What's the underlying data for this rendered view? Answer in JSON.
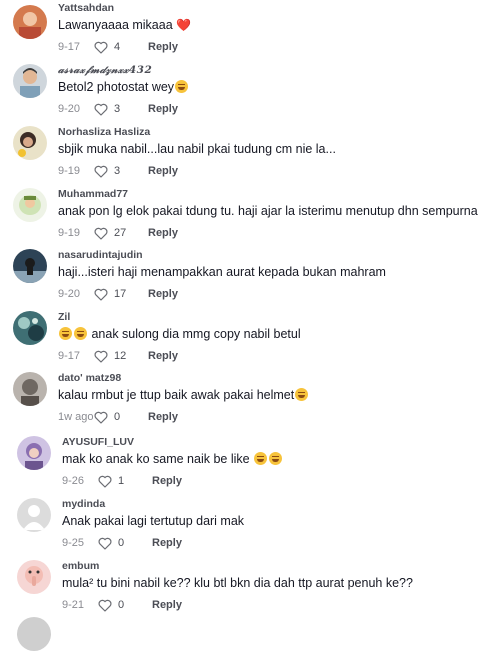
{
  "comments": [
    {
      "user": "Yattsahdan",
      "text": "Lawanyaaaa mikaaa",
      "suffix": "❤️",
      "date": "9-17",
      "likes": "4",
      "reply": "Reply"
    },
    {
      "user": "𝒶𝓈𝓇𝒶𝓍𝒻𝓂𝒹𝓏𝓃𝓍𝓍432",
      "text": "Betol2 photostat wey",
      "suffix": "😂",
      "date": "9-20",
      "likes": "3",
      "reply": "Reply"
    },
    {
      "user": "Norhasliza Hasliza",
      "text": "sbjik muka nabil...lau nabil pkai tudung cm nie la...",
      "suffix": "",
      "date": "9-19",
      "likes": "3",
      "reply": "Reply"
    },
    {
      "user": "Muhammad77",
      "text": "anak pon lg elok pakai tdung tu. haji ajar la isterimu menutup dhn sempurna",
      "suffix": "",
      "date": "9-19",
      "likes": "27",
      "reply": "Reply"
    },
    {
      "user": "nasarudintajudin",
      "text": "haji...isteri haji menampakkan aurat kepada bukan mahram",
      "suffix": "",
      "date": "9-20",
      "likes": "17",
      "reply": "Reply"
    },
    {
      "user": "Zil",
      "prefix": "🤣🤣",
      "text": " anak sulong dia mmg copy nabil betul",
      "suffix": "",
      "date": "9-17",
      "likes": "12",
      "reply": "Reply"
    },
    {
      "user": "dato' matz98",
      "text": "kalau rmbut je ttup baik awak pakai helmet",
      "suffix": "😂",
      "date": "1w ago",
      "likes": "0",
      "reply": "Reply"
    },
    {
      "user": "AYUSUFI_LUV",
      "text": "mak ko anak ko same naik be like ",
      "suffix": "😂😂",
      "date": "9-26",
      "likes": "1",
      "reply": "Reply"
    },
    {
      "user": "mydinda",
      "text": "Anak pakai lagi tertutup dari mak",
      "suffix": "",
      "date": "9-25",
      "likes": "0",
      "reply": "Reply"
    },
    {
      "user": "embum",
      "text": "mula² tu bini nabil ke?? klu btl bkn dia dah ttp aurat penuh ke??",
      "suffix": "",
      "date": "9-21",
      "likes": "0",
      "reply": "Reply"
    }
  ],
  "icons": {
    "like": "heart-outline-icon"
  },
  "colors": {
    "text": "#161823",
    "muted": "#8a8b91",
    "username": "#4b4d55"
  }
}
